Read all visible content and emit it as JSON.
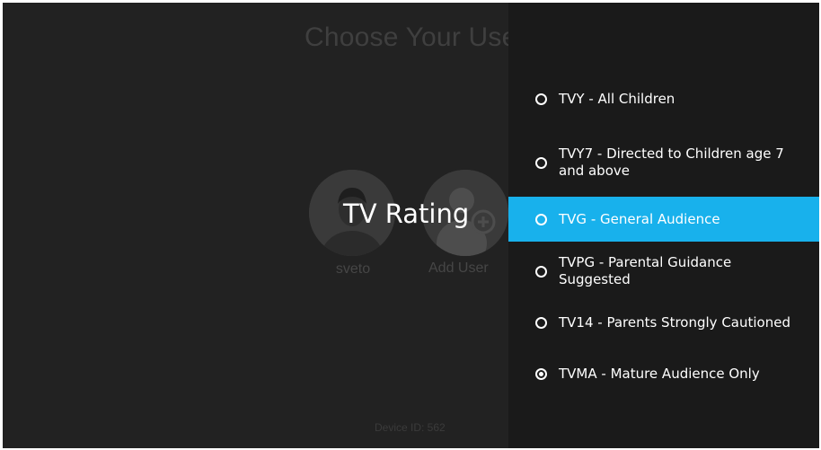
{
  "background": {
    "title": "Choose Your Use",
    "users": [
      {
        "label": "sveto"
      },
      {
        "label": "Add User"
      }
    ],
    "device_id": "Device ID: 562"
  },
  "dialog": {
    "title": "TV Rating"
  },
  "ratings": {
    "options": [
      {
        "label": "TVY - All Children",
        "checked": false
      },
      {
        "label": "TVY7 - Directed to Children age 7 and above",
        "checked": false
      },
      {
        "label": "TVG - General Audience",
        "checked": false
      },
      {
        "label": "TVPG - Parental Guidance Suggested",
        "checked": false
      },
      {
        "label": "TV14 - Parents Strongly Cautioned",
        "checked": false
      },
      {
        "label": "TVMA - Mature Audience Only",
        "checked": true
      }
    ],
    "focused_index": 2
  },
  "colors": {
    "screen_bg": "#222222",
    "panel_bg": "#1a1a1a",
    "focus_highlight": "#18b1ec",
    "text_primary": "#ffffff"
  },
  "icons": {
    "radio_unchecked": "radio-unchecked-icon",
    "radio_checked": "radio-checked-icon",
    "user_avatar": "user-avatar-icon",
    "add_user": "add-user-icon"
  }
}
